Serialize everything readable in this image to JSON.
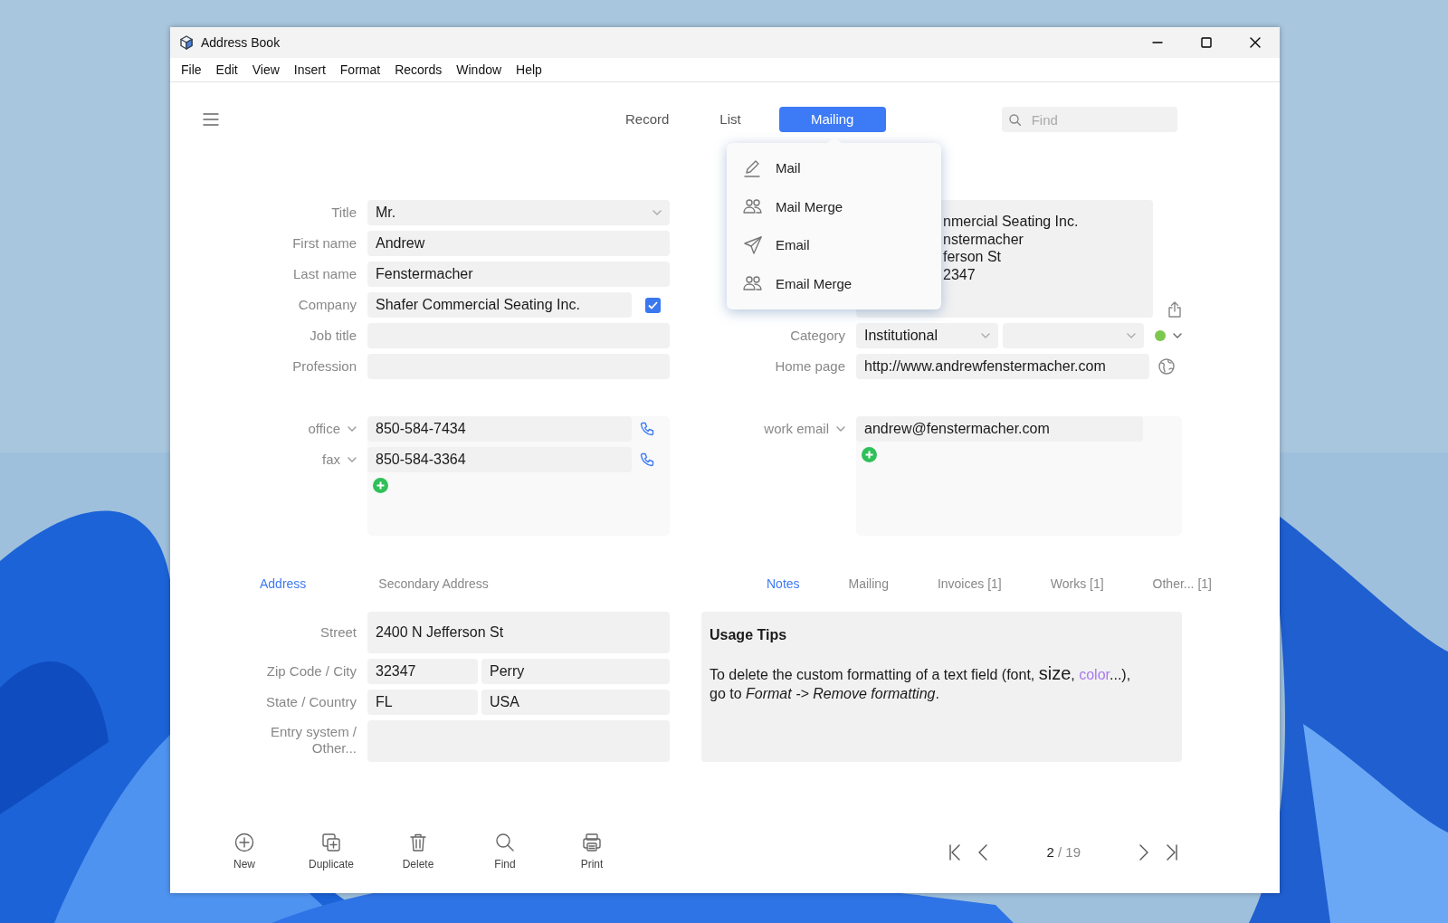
{
  "window": {
    "title": "Address Book"
  },
  "menu": [
    "File",
    "Edit",
    "View",
    "Insert",
    "Format",
    "Records",
    "Window",
    "Help"
  ],
  "view_tabs": [
    {
      "label": "Record",
      "selected": false
    },
    {
      "label": "List",
      "selected": false
    },
    {
      "label": "Mailing",
      "selected": true
    }
  ],
  "search": {
    "placeholder": "Find"
  },
  "mailing_menu": [
    {
      "label": "Mail",
      "kind": "pen"
    },
    {
      "label": "Mail Merge",
      "kind": "people"
    },
    {
      "label": "Email",
      "kind": "send"
    },
    {
      "label": "Email Merge",
      "kind": "people"
    }
  ],
  "fields": [
    {
      "label": "Title",
      "value": "Mr.",
      "kind": "select"
    },
    {
      "label": "First name",
      "value": "Andrew",
      "kind": "text"
    },
    {
      "label": "Last name",
      "value": "Fenstermacher",
      "kind": "text"
    },
    {
      "label": "Company",
      "value": "Shafer Commercial Seating Inc.",
      "kind": "checkbox",
      "checked": true
    },
    {
      "label": "Job title",
      "kind": "text"
    },
    {
      "label": "Profession",
      "kind": "text"
    }
  ],
  "mailing_label": {
    "lines": [
      "nmercial Seating Inc.",
      "nstermacher",
      "ferson St",
      "2347"
    ]
  },
  "category": {
    "label": "Category",
    "value": "Institutional",
    "color": "#7cc84f"
  },
  "home_page": {
    "label": "Home page",
    "value": "http://www.andrewfenstermacher.com"
  },
  "phones": [
    {
      "label": "office",
      "value": "850-584-7434"
    },
    {
      "label": "fax",
      "value": "850-584-3364"
    }
  ],
  "emails": [
    {
      "label": "work email",
      "value": "andrew@fenstermacher.com"
    }
  ],
  "address_tabs": [
    {
      "label": "Address",
      "selected": true
    },
    {
      "label": "Secondary Address",
      "selected": false
    }
  ],
  "address_fields": {
    "street_label": "Street",
    "street": "2400 N Jefferson St",
    "zip_city_label": "Zip Code / City",
    "zip": "32347",
    "city": "Perry",
    "state_country_label": "State / Country",
    "state": "FL",
    "country": "USA",
    "entry_label": "Entry system / Other..."
  },
  "notes_tabs": [
    {
      "label": "Notes",
      "selected": true
    },
    {
      "label": "Mailing",
      "selected": false
    },
    {
      "label": "Invoices [1]",
      "selected": false
    },
    {
      "label": "Works [1]",
      "selected": false
    },
    {
      "label": "Other... [1]",
      "selected": false
    }
  ],
  "notes": {
    "title": "Usage Tips",
    "lines": [
      [
        {
          "text": "To delete the custom formatting of a text  field (font, ",
          "kind": "plain"
        },
        {
          "text": "size",
          "kind": "large"
        },
        {
          "text": ", ",
          "kind": "plain"
        },
        {
          "text": "color",
          "kind": "accent"
        },
        {
          "text": "...),",
          "kind": "plain"
        }
      ],
      [
        {
          "text": "go to *Format -> Remove formatting*.",
          "kind": "plain"
        }
      ]
    ]
  },
  "toolbar": [
    {
      "label": "New",
      "kind": "new"
    },
    {
      "label": "Duplicate",
      "kind": "duplicate"
    },
    {
      "label": "Delete",
      "kind": "delete"
    },
    {
      "label": "Find",
      "kind": "find"
    },
    {
      "label": "Print",
      "kind": "print"
    }
  ],
  "pager": {
    "current": "2",
    "separator": "/",
    "total": "19"
  }
}
